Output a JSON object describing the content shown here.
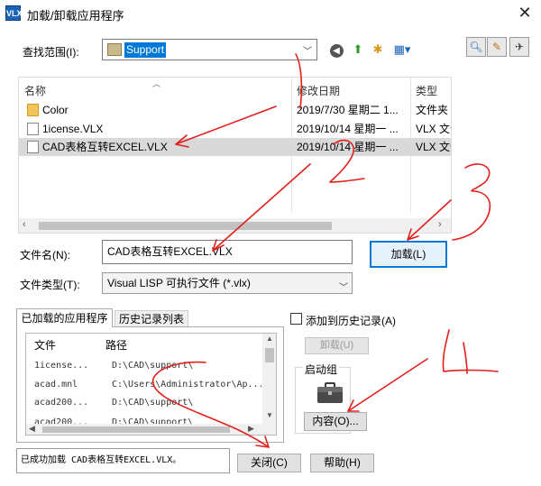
{
  "window": {
    "icon_text": "VLX",
    "title": "加载/卸载应用程序",
    "close_glyph": "✕"
  },
  "look_in": {
    "label": "查找范围(I):",
    "value": "Support"
  },
  "file_list": {
    "columns": [
      "名称",
      "修改日期",
      "类型"
    ],
    "rows": [
      {
        "name": "Color",
        "date": "2019/7/30 星期二 1...",
        "type": "文件夹",
        "icon": "folder-icon"
      },
      {
        "name": "1icense.VLX",
        "date": "2019/10/14 星期一 ...",
        "type": "VLX 文件",
        "icon": "file-icon"
      },
      {
        "name": "CAD表格互转EXCEL.VLX",
        "date": "2019/10/14 星期一 ...",
        "type": "VLX 文件",
        "icon": "file-icon"
      }
    ]
  },
  "file_name": {
    "label": "文件名(N):",
    "value": "CAD表格互转EXCEL.VLX"
  },
  "file_type": {
    "label": "文件类型(T):",
    "value": "Visual LISP 可执行文件 (*.vlx)"
  },
  "buttons": {
    "load": "加载(L)",
    "unload": "卸载(U)",
    "contents": "内容(O)...",
    "close": "关闭(C)",
    "help": "帮助(H)"
  },
  "tabs": [
    "已加载的应用程序",
    "历史记录列表"
  ],
  "loaded_apps": {
    "columns": [
      "文件",
      "路径"
    ],
    "rows": [
      {
        "file": "1icense...",
        "path": "D:\\CAD\\support\\"
      },
      {
        "file": "acad.mnl",
        "path": "C:\\Users\\Administrator\\Ap..."
      },
      {
        "file": "acad200...",
        "path": "D:\\CAD\\support\\"
      },
      {
        "file": "acad200...",
        "path": "D:\\CAD\\support\\"
      }
    ]
  },
  "history_checkbox": {
    "label": "添加到历史记录(A)",
    "checked": false
  },
  "startup_group": {
    "label": "启动组"
  },
  "status_text": "已成功加载 CAD表格互转EXCEL.VLX。",
  "colors": {
    "selection": "#0078d7",
    "annotation": "#e0201b",
    "selected_row": "#d9d9d9"
  }
}
